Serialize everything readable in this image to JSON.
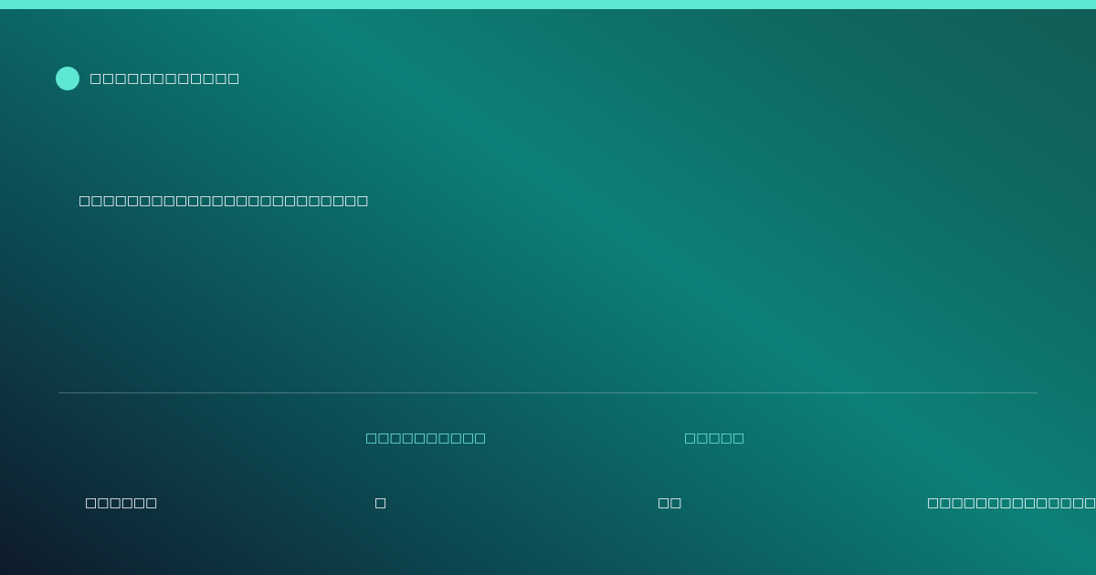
{
  "colors": {
    "accent": "#5ee7d2",
    "label": "#6ff0d9",
    "text": "#ffffff"
  },
  "brand": {
    "name": "□□□□□□□□□□□□"
  },
  "headline": "□□□□□□□□□□□□□□□□□□□□□□□□",
  "stats": {
    "label_1": "□□□□□□□□□□",
    "label_2": "□□□□□"
  },
  "footer": {
    "item_1": "□□□□□□",
    "item_2": "□",
    "item_3": "□□",
    "item_4": "□□□□□□□□□□□□□□□□"
  }
}
